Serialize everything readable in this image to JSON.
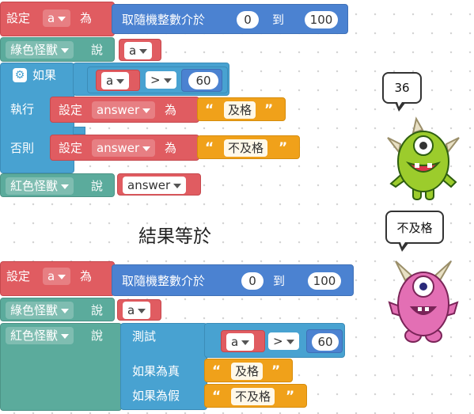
{
  "program1": {
    "set_block": {
      "set": "設定",
      "var": "a",
      "to": "為"
    },
    "random_block": {
      "label": "取隨機整數介於",
      "from": "0",
      "and": "到",
      "to": "100"
    },
    "say_green": {
      "sprite": "綠色怪獸",
      "say": "說",
      "var": "a"
    },
    "if_block": {
      "if": "如果",
      "var": "a",
      "op": ">",
      "value": "60",
      "then": "執行",
      "else": "否則"
    },
    "then_set": {
      "set": "設定",
      "var": "answer",
      "to": "為",
      "text": "及格"
    },
    "else_set": {
      "set": "設定",
      "var": "answer",
      "to": "為",
      "text": "不及格"
    },
    "say_red": {
      "sprite": "紅色怪獸",
      "say": "說",
      "var": "answer"
    }
  },
  "result_label": "結果等於",
  "program2": {
    "set_block": {
      "set": "設定",
      "var": "a",
      "to": "為"
    },
    "random_block": {
      "label": "取隨機整數介於",
      "from": "0",
      "and": "到",
      "to": "100"
    },
    "say_green": {
      "sprite": "綠色怪獸",
      "say": "說",
      "var": "a"
    },
    "say_red": {
      "sprite": "紅色怪獸",
      "say": "說",
      "ternary": {
        "test": "測試",
        "var": "a",
        "op": ">",
        "value": "60",
        "if_true": "如果為真",
        "true_text": "及格",
        "if_false": "如果為假",
        "false_text": "不及格"
      }
    }
  },
  "green_monster": {
    "speech": "36",
    "color": "#9ccc2c"
  },
  "red_monster": {
    "speech": "不及格",
    "color": "#e36fb4"
  },
  "colors": {
    "variables": "#e05c61",
    "math": "#4b82d1",
    "logic": "#48a2d1",
    "sprite": "#5bab9c",
    "text": "#f0a11a"
  }
}
